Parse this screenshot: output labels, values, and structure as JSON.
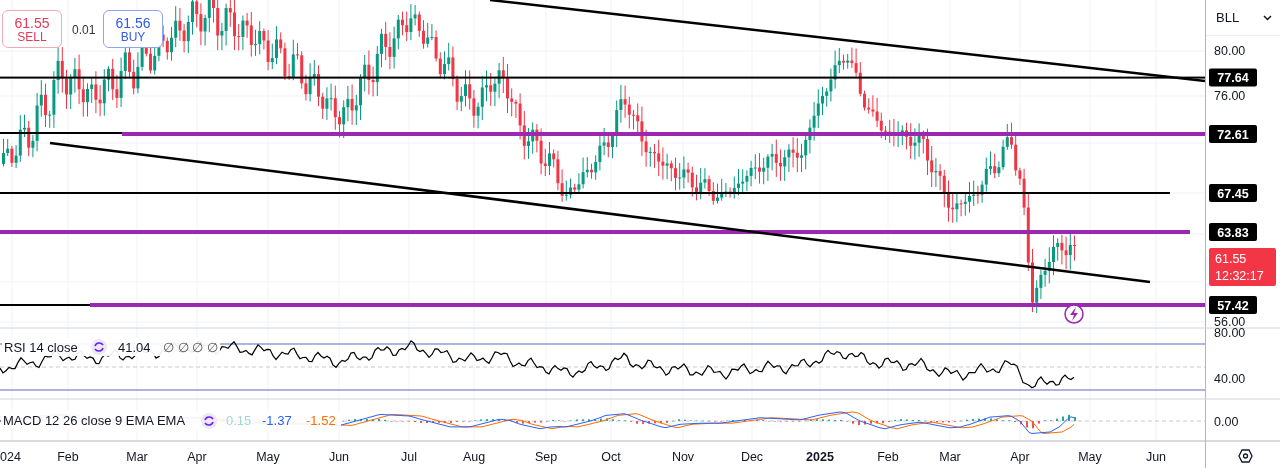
{
  "order_panel": {
    "sell": {
      "price": "61.55",
      "label": "SELL"
    },
    "spread": "0.01",
    "buy": {
      "price": "61.56",
      "label": "BUY"
    }
  },
  "symbol_menu": {
    "label": "BLL"
  },
  "price_axis": [
    "80.00",
    "76.00",
    "56.00"
  ],
  "levels": [
    {
      "price": "77.64",
      "color": "#000000"
    },
    {
      "price": "72.61",
      "color": "#9c27b0"
    },
    {
      "price": "67.45",
      "color": "#000000"
    },
    {
      "price": "63.83",
      "color": "#9c27b0"
    },
    {
      "price": "57.42",
      "color": "#9c27b0"
    }
  ],
  "last_price": {
    "price": "61.55",
    "countdown": "12:32:17"
  },
  "rsi": {
    "label": "RSI 14 close",
    "value": "41.04",
    "extras": [
      "∅",
      "∅",
      "∅",
      "∅"
    ],
    "axis": [
      "80.00",
      "40.00"
    ]
  },
  "macd": {
    "label": "MACD 12 26 close 9 EMA EMA",
    "values": [
      {
        "text": "0.15",
        "color": "#9fd8d2"
      },
      {
        "text": "-1.37",
        "color": "#2962ff"
      },
      {
        "text": "-1.52",
        "color": "#ff6d00"
      }
    ],
    "axis": [
      "0.00"
    ]
  },
  "time_axis": [
    {
      "label": "024",
      "bold": false
    },
    {
      "label": "Feb",
      "bold": false
    },
    {
      "label": "Mar",
      "bold": false
    },
    {
      "label": "Apr",
      "bold": false
    },
    {
      "label": "May",
      "bold": false
    },
    {
      "label": "Jun",
      "bold": false
    },
    {
      "label": "Jul",
      "bold": false
    },
    {
      "label": "Aug",
      "bold": false
    },
    {
      "label": "Sep",
      "bold": false
    },
    {
      "label": "Oct",
      "bold": false
    },
    {
      "label": "Nov",
      "bold": false
    },
    {
      "label": "Dec",
      "bold": false
    },
    {
      "label": "2025",
      "bold": true
    },
    {
      "label": "Feb",
      "bold": false
    },
    {
      "label": "Mar",
      "bold": false
    },
    {
      "label": "Apr",
      "bold": false
    },
    {
      "label": "May",
      "bold": false
    },
    {
      "label": "Jun",
      "bold": false
    }
  ]
}
